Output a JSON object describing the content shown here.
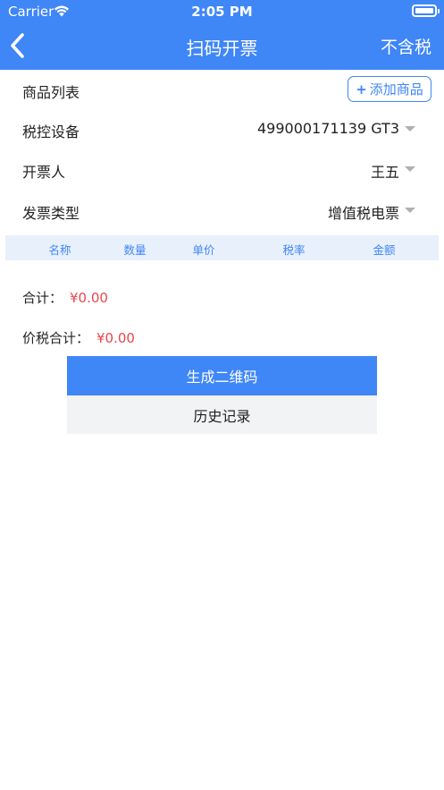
{
  "status_bar": {
    "carrier": "Carrier",
    "time": "2:05 PM"
  },
  "nav": {
    "title": "扫码开票",
    "right_action": "不含税",
    "back_icon": "chevron-left-icon"
  },
  "form": {
    "goods_label": "商品列表",
    "add_button": {
      "plus": "+",
      "label": "添加商品"
    },
    "device_label": "税控设备",
    "device_value": "499000171139 GT3",
    "issuer_label": "开票人",
    "issuer_value": "王五",
    "invoice_type_label": "发票类型",
    "invoice_type_value": "增值税电票"
  },
  "table": {
    "columns": [
      "名称",
      "数量",
      "单价",
      "税率",
      "金额"
    ]
  },
  "totals": {
    "subtotal_label": "合计：",
    "subtotal_value": "¥0.00",
    "tax_total_label": "价税合计：",
    "tax_total_value": "¥0.00"
  },
  "actions": {
    "generate_qr": "生成二维码",
    "history": "历史记录"
  },
  "colors": {
    "accent": "#3f86f7",
    "amount": "#e8474c",
    "table_header_bg": "#e8f0fb"
  }
}
